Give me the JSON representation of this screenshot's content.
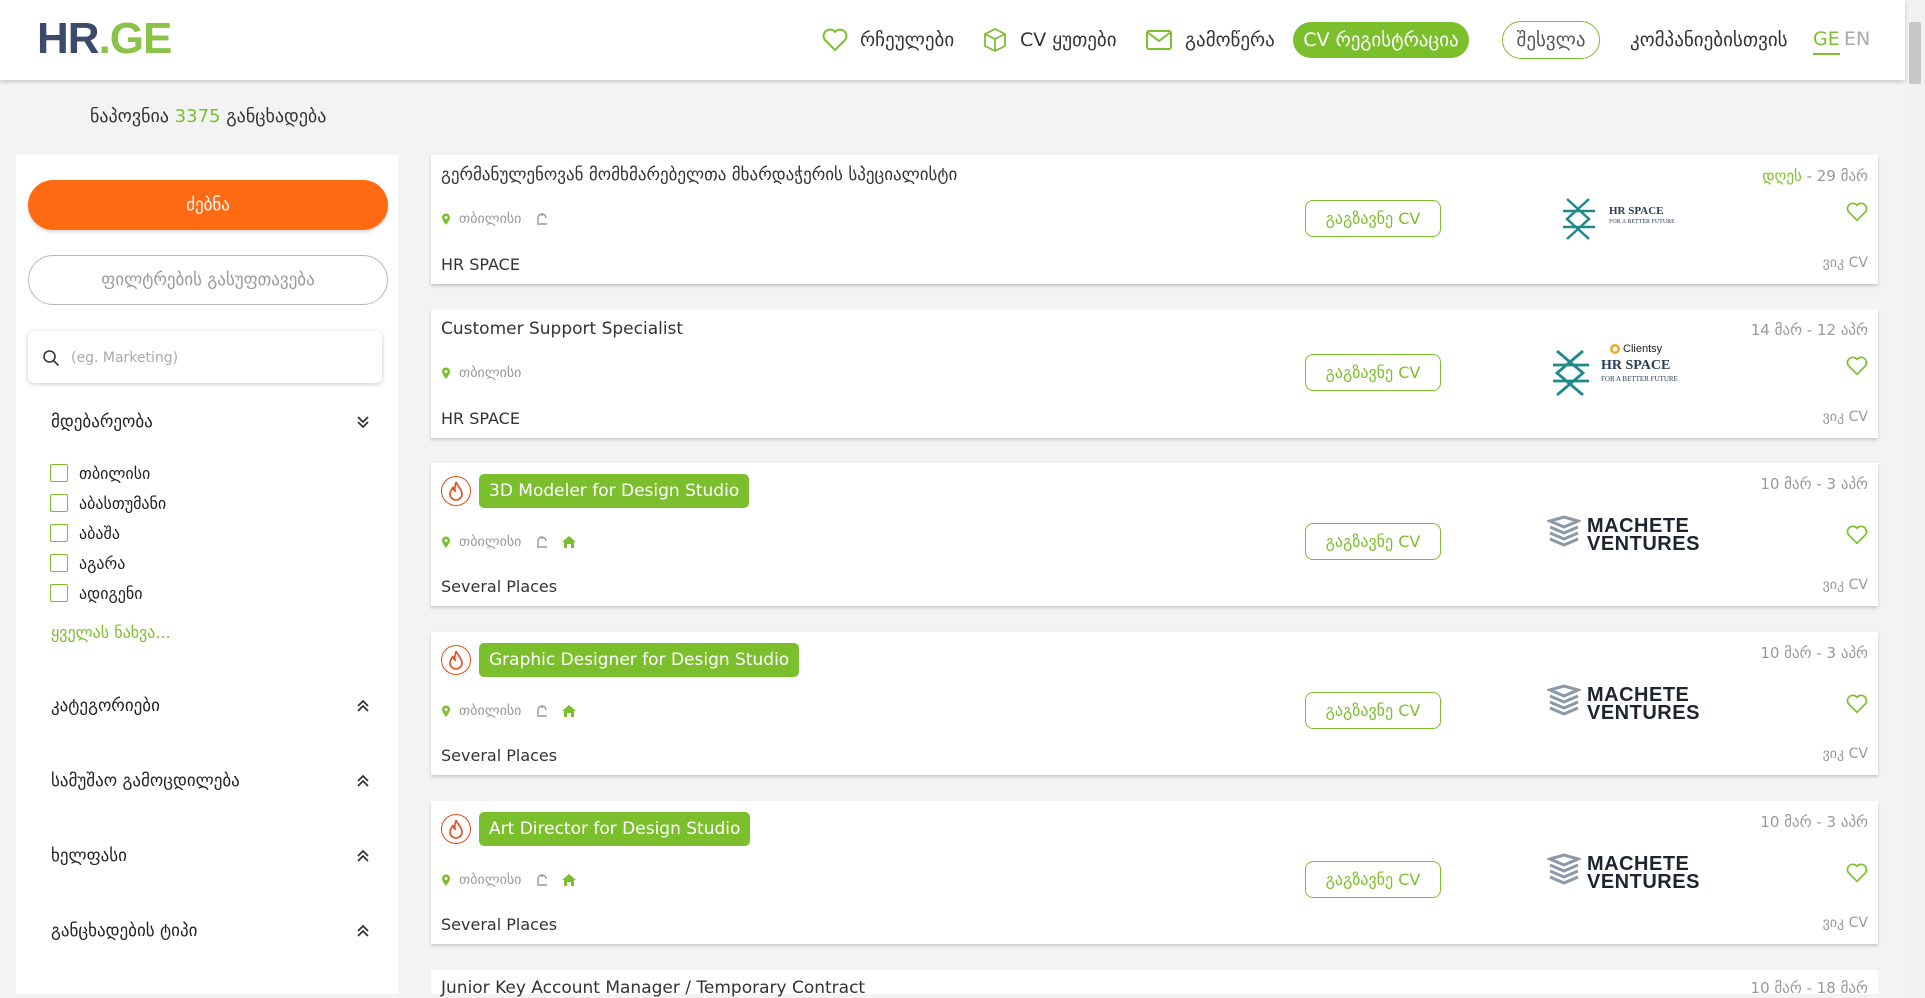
{
  "header": {
    "logo": {
      "hr": "HR",
      "dot": ".",
      "ge": "GE"
    },
    "nav": {
      "favorites": "რჩეულები",
      "cv_boxes": "CV ყუთები",
      "subscribe": "გამოწერა",
      "cv_register": "CV რეგისტრაცია",
      "login": "შესვლა",
      "for_companies": "კომპანიებისთვის",
      "lang_ge": "GE",
      "lang_en": "EN"
    }
  },
  "results": {
    "prefix": "ნაპოვნია",
    "count": "3375",
    "suffix": "განცხადება"
  },
  "sidebar": {
    "search_button": "ძებნა",
    "clear_filters": "ფილტრების გასუფთავება",
    "keyword_placeholder": "(eg. Marketing)",
    "location": {
      "title": "მდებარეობა",
      "options": [
        "თბილისი",
        "აბასთუმანი",
        "აბაშა",
        "აგარა",
        "ადიგენი"
      ],
      "see_all": "ყველას ნახვა..."
    },
    "filters": [
      "კატეგორიები",
      "სამუშაო გამოცდილება",
      "ხელფასი",
      "განცხადების ტიპი"
    ]
  },
  "jobs": [
    {
      "title": "გერმანულენოვან მომხმარებელთა მხარდაჭერის სპეციალისტი",
      "hot": false,
      "city": "თბილისი",
      "remote": false,
      "company": "HR SPACE",
      "date_today": "დღეს",
      "date_rest": " - 29 მარ",
      "send_cv": "გაგზავნე CV",
      "cv_tag": "ვიკ CV",
      "logo": "hrspace"
    },
    {
      "title": "Customer Support Specialist",
      "hot": false,
      "city": "თბილისი",
      "remote": false,
      "company": "HR SPACE",
      "date_today": "",
      "date_rest": "14 მარ - 12 აპრ",
      "send_cv": "გაგზავნე CV",
      "cv_tag": "ვიკ CV",
      "logo": "hrspace-clientsy",
      "logo_extra": "Clientsy"
    },
    {
      "title": "3D Modeler for Design Studio",
      "hot": true,
      "city": "თბილისი",
      "remote": true,
      "company": "Several Places",
      "date_today": "",
      "date_rest": "10 მარ - 3 აპრ",
      "send_cv": "გაგზავნე CV",
      "cv_tag": "ვიკ CV",
      "logo": "machete"
    },
    {
      "title": "Graphic Designer for Design Studio",
      "hot": true,
      "city": "თბილისი",
      "remote": true,
      "company": "Several Places",
      "date_today": "",
      "date_rest": "10 მარ - 3 აპრ",
      "send_cv": "გაგზავნე CV",
      "cv_tag": "ვიკ CV",
      "logo": "machete"
    },
    {
      "title": "Art Director for Design Studio",
      "hot": true,
      "city": "თბილისი",
      "remote": true,
      "company": "Several Places",
      "date_today": "",
      "date_rest": "10 მარ - 3 აპრ",
      "send_cv": "გაგზავნე CV",
      "cv_tag": "ვიკ CV",
      "logo": "machete"
    },
    {
      "title": "Junior Key Account Manager / Temporary Contract",
      "hot": false,
      "city": "",
      "remote": false,
      "company": "",
      "date_today": "",
      "date_rest": "10 მარ - 18 მარ",
      "send_cv": "",
      "cv_tag": "",
      "logo": ""
    }
  ],
  "logos": {
    "hrspace_line1": "HR SPACE",
    "hrspace_line2": "FOR A BETTER FUTURE",
    "machete_line1": "MACHETE",
    "machete_line2": "VENTURES"
  },
  "colors": {
    "accent": "#7cbf2d",
    "orange": "#ff6a13",
    "navy": "#3d4a6b",
    "hot": "#e64a19"
  }
}
